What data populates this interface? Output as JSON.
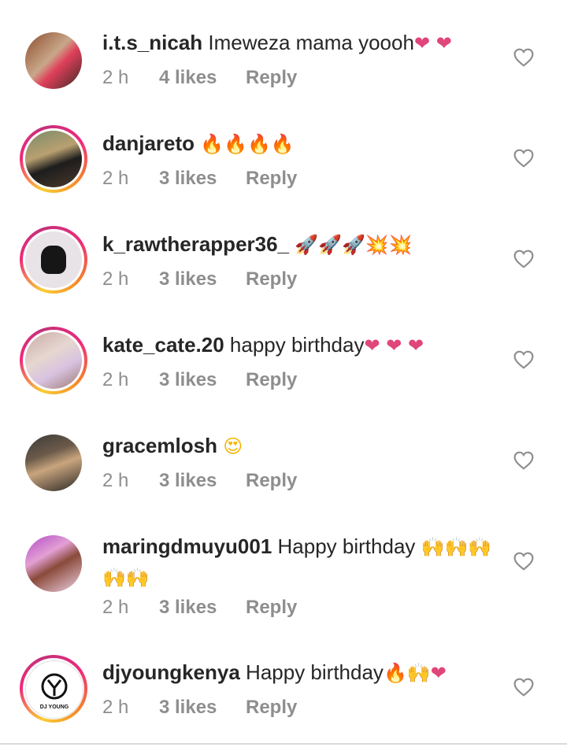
{
  "colors": {
    "username": "#262626",
    "meta": "#8e8e8e",
    "heart_emoji": "#e0457b",
    "ring_start": "#f9ce34",
    "ring_end": "#ee2a7b"
  },
  "comments": [
    {
      "username": "i.t.s_nicah",
      "text": " Imeweza mama yoooh",
      "emoji": "❤ ❤",
      "emoji_line2": "",
      "time": "2 h",
      "likes": "4 likes",
      "reply": "Reply",
      "story_ring": false
    },
    {
      "username": "danjareto",
      "text": " ",
      "emoji": "🔥🔥🔥🔥",
      "emoji_line2": "",
      "time": "2 h",
      "likes": "3 likes",
      "reply": "Reply",
      "story_ring": true
    },
    {
      "username": "k_rawtherapper36_",
      "text": " ",
      "emoji": "🚀🚀🚀💥💥",
      "emoji_line2": "",
      "time": "2 h",
      "likes": "3 likes",
      "reply": "Reply",
      "story_ring": true
    },
    {
      "username": "kate_cate.20",
      "text": " happy birthday",
      "emoji": "❤ ❤ ❤",
      "emoji_line2": "",
      "time": "2 h",
      "likes": "3 likes",
      "reply": "Reply",
      "story_ring": true
    },
    {
      "username": "gracemlosh",
      "text": " ",
      "emoji": "😍",
      "emoji_line2": "",
      "time": "2 h",
      "likes": "3 likes",
      "reply": "Reply",
      "story_ring": false
    },
    {
      "username": "maringdmuyu001",
      "text": " Happy birthday ",
      "emoji": "🙌🙌🙌",
      "emoji_line2": "🙌🙌",
      "time": "2 h",
      "likes": "3 likes",
      "reply": "Reply",
      "story_ring": false
    },
    {
      "username": "djyoungkenya",
      "text": " Happy birthday",
      "emoji": "🔥🙌❤",
      "emoji_line2": "",
      "time": "2 h",
      "likes": "3 likes",
      "reply": "Reply",
      "story_ring": true,
      "avatar_logo_text": "DJ YOUNG"
    }
  ]
}
